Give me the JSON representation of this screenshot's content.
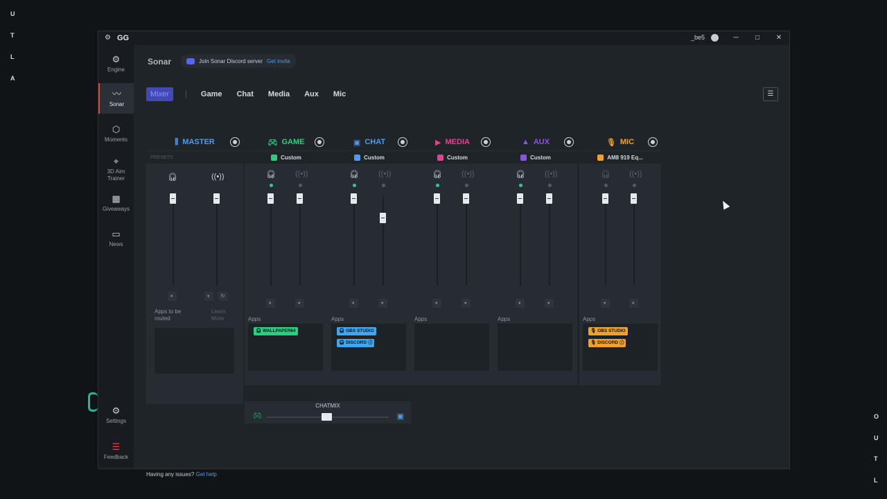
{
  "desktop": {
    "left_letters": [
      "U",
      "T",
      "L",
      "A"
    ],
    "right_letters_bottom": [
      "O",
      "U",
      "T",
      "L"
    ]
  },
  "titlebar": {
    "app_logo": "GG",
    "username": "_be5"
  },
  "sidebar": {
    "items": [
      {
        "label": "Engine",
        "icon": "engine-icon"
      },
      {
        "label": "Sonar",
        "icon": "sonar-icon",
        "active": true
      },
      {
        "label": "Moments",
        "icon": "moments-icon"
      },
      {
        "label": "3D Aim Trainer",
        "icon": "aim-trainer-icon"
      },
      {
        "label": "Giveaways",
        "icon": "gift-icon"
      },
      {
        "label": "News",
        "icon": "news-icon"
      },
      {
        "label": "Settings",
        "icon": "gear-icon"
      },
      {
        "label": "Feedback",
        "icon": "feedback-icon"
      }
    ]
  },
  "header": {
    "title": "Sonar",
    "discord_text": "Join Sonar Discord server",
    "discord_link": "Get invite"
  },
  "tabs": [
    "Mixer",
    "Game",
    "Chat",
    "Media",
    "Aux",
    "Mic"
  ],
  "presets_label": "PRESETS",
  "channels": [
    {
      "name": "MASTER",
      "color": "#4e9bf0",
      "preset": "",
      "icon": "sliders-icon",
      "apps_label": "Apps to be routed",
      "learn_more": "Learn More",
      "apps": []
    },
    {
      "name": "GAME",
      "color": "#27d07f",
      "preset": "Custom",
      "icon": "gamepad-icon",
      "apps_label": "Apps",
      "apps": [
        {
          "name": "WALLPAPER64",
          "color": "#27d07f"
        }
      ]
    },
    {
      "name": "CHAT",
      "color": "#4e9bf0",
      "preset": "Custom",
      "icon": "chat-icon",
      "apps_label": "Apps",
      "apps": [
        {
          "name": "OBS STUDIO",
          "color": "#3fa7f0"
        },
        {
          "name": "DISCORD",
          "color": "#3fa7f0"
        }
      ]
    },
    {
      "name": "MEDIA",
      "color": "#e8408e",
      "preset": "Custom",
      "icon": "play-icon",
      "apps_label": "Apps",
      "apps": []
    },
    {
      "name": "AUX",
      "color": "#8a52e8",
      "preset": "Custom",
      "icon": "shapes-icon",
      "apps_label": "Apps",
      "apps": []
    },
    {
      "name": "MIC",
      "color": "#f0a12c",
      "preset": "AM8 919 Eq...",
      "icon": "mic-icon",
      "apps_label": "Apps",
      "apps": [
        {
          "name": "OBS STUDIO",
          "color": "#f0a12c"
        },
        {
          "name": "DISCORD",
          "color": "#f0a12c"
        }
      ]
    }
  ],
  "chatmix": {
    "label": "CHATMIX",
    "balance": 0.5
  },
  "help": {
    "text": "Having any issues?",
    "link": "Get help"
  }
}
